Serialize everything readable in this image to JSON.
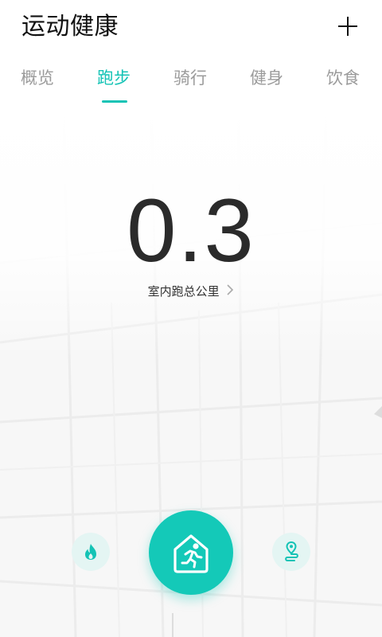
{
  "header": {
    "title": "运动健康",
    "add_icon": "plus-icon"
  },
  "tabs": [
    {
      "label": "概览",
      "active": false
    },
    {
      "label": "跑步",
      "active": true
    },
    {
      "label": "骑行",
      "active": false
    },
    {
      "label": "健身",
      "active": false
    },
    {
      "label": "饮食",
      "active": false
    }
  ],
  "main": {
    "distance_value": "0.3",
    "distance_label": "室内跑总公里"
  },
  "controls": {
    "left_icon": "flame-icon",
    "center_icon": "indoor-run-icon",
    "right_icon": "route-pin-icon"
  },
  "colors": {
    "accent": "#14c3b5",
    "accent_button": "#14c9b8",
    "circle_bg": "#e4f5f3",
    "text_primary": "#111111",
    "tab_inactive": "#9b9b9b"
  }
}
